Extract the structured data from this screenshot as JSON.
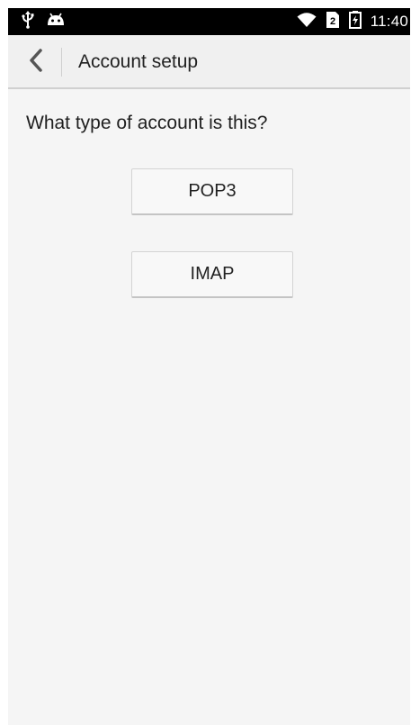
{
  "status_bar": {
    "time": "11:40",
    "icons": [
      "usb-icon",
      "android-debug-icon",
      "wifi-icon",
      "sim-card-icon",
      "battery-icon"
    ]
  },
  "app_bar": {
    "title": "Account setup",
    "back_icon": "chevron-left-icon"
  },
  "content": {
    "question": "What type of account is this?",
    "options": [
      {
        "label": "POP3"
      },
      {
        "label": "IMAP"
      }
    ]
  },
  "colors": {
    "status_bar_bg": "#000000",
    "app_bar_bg": "#f0f0f0",
    "screen_bg": "#f5f5f5",
    "button_bg": "#f8f8f8"
  }
}
